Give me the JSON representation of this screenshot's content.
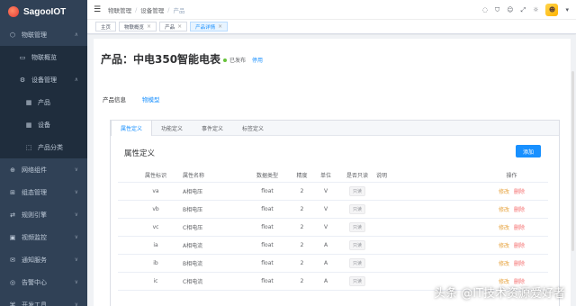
{
  "app": {
    "name": "SagooIOT"
  },
  "sidebar": {
    "items": [
      {
        "icon": "⬡",
        "label": "物联管理",
        "chev": "∧",
        "level": 1
      },
      {
        "icon": "▭",
        "label": "物联概览",
        "chev": "",
        "level": 2
      },
      {
        "icon": "⚙",
        "label": "设备管理",
        "chev": "∧",
        "level": 2
      },
      {
        "icon": "▦",
        "label": "产品",
        "chev": "",
        "level": 3
      },
      {
        "icon": "▦",
        "label": "设备",
        "chev": "",
        "level": 3
      },
      {
        "icon": "⬚",
        "label": "产品分类",
        "chev": "",
        "level": 3
      },
      {
        "icon": "⊕",
        "label": "网络组件",
        "chev": "∨",
        "level": 1
      },
      {
        "icon": "⊞",
        "label": "组态管理",
        "chev": "∨",
        "level": 1
      },
      {
        "icon": "⇄",
        "label": "规则引擎",
        "chev": "∨",
        "level": 1
      },
      {
        "icon": "▣",
        "label": "视频监控",
        "chev": "∨",
        "level": 1
      },
      {
        "icon": "✉",
        "label": "通知服务",
        "chev": "∨",
        "level": 1
      },
      {
        "icon": "◎",
        "label": "告警中心",
        "chev": "∨",
        "level": 1
      },
      {
        "icon": "⌘",
        "label": "开发工具",
        "chev": "∨",
        "level": 1
      }
    ]
  },
  "header": {
    "breadcrumb": [
      "物联管理",
      "设备管理",
      "产品"
    ],
    "icons": [
      "◌",
      "⛉",
      "☺",
      "⤢",
      "☼"
    ]
  },
  "tags": [
    {
      "label": "主页",
      "closable": false,
      "active": false
    },
    {
      "label": "物联概览",
      "closable": true,
      "active": false
    },
    {
      "label": "产品",
      "closable": true,
      "active": false
    },
    {
      "label": "产品详情",
      "closable": true,
      "active": true
    }
  ],
  "product": {
    "title": "产品：中电350智能电表",
    "status": "已发布",
    "action": "停用"
  },
  "page_tabs": [
    {
      "label": "产品信息",
      "active": false
    },
    {
      "label": "物模型",
      "active": true
    }
  ],
  "model_tabs": [
    {
      "label": "属性定义",
      "active": true
    },
    {
      "label": "功能定义",
      "active": false
    },
    {
      "label": "事件定义",
      "active": false
    },
    {
      "label": "标签定义",
      "active": false
    }
  ],
  "section": {
    "title": "属性定义",
    "add_label": "添加"
  },
  "table": {
    "headers": [
      "属性标识",
      "属性名称",
      "数据类型",
      "精度",
      "单位",
      "是否只读",
      "说明",
      "操作"
    ],
    "rows": [
      {
        "key": "va",
        "name": "A相电压",
        "type": "float",
        "precision": "2",
        "unit": "V",
        "readonly": "只读",
        "desc": ""
      },
      {
        "key": "vb",
        "name": "B相电压",
        "type": "float",
        "precision": "2",
        "unit": "V",
        "readonly": "只读",
        "desc": ""
      },
      {
        "key": "vc",
        "name": "C相电压",
        "type": "float",
        "precision": "2",
        "unit": "V",
        "readonly": "只读",
        "desc": ""
      },
      {
        "key": "ia",
        "name": "A相电流",
        "type": "float",
        "precision": "2",
        "unit": "A",
        "readonly": "只读",
        "desc": ""
      },
      {
        "key": "ib",
        "name": "B相电流",
        "type": "float",
        "precision": "2",
        "unit": "A",
        "readonly": "只读",
        "desc": ""
      },
      {
        "key": "ic",
        "name": "C相电流",
        "type": "float",
        "precision": "2",
        "unit": "A",
        "readonly": "只读",
        "desc": ""
      }
    ],
    "edit_label": "修改",
    "delete_label": "删除"
  },
  "watermark": "头条 @IT技术资源爱好者"
}
